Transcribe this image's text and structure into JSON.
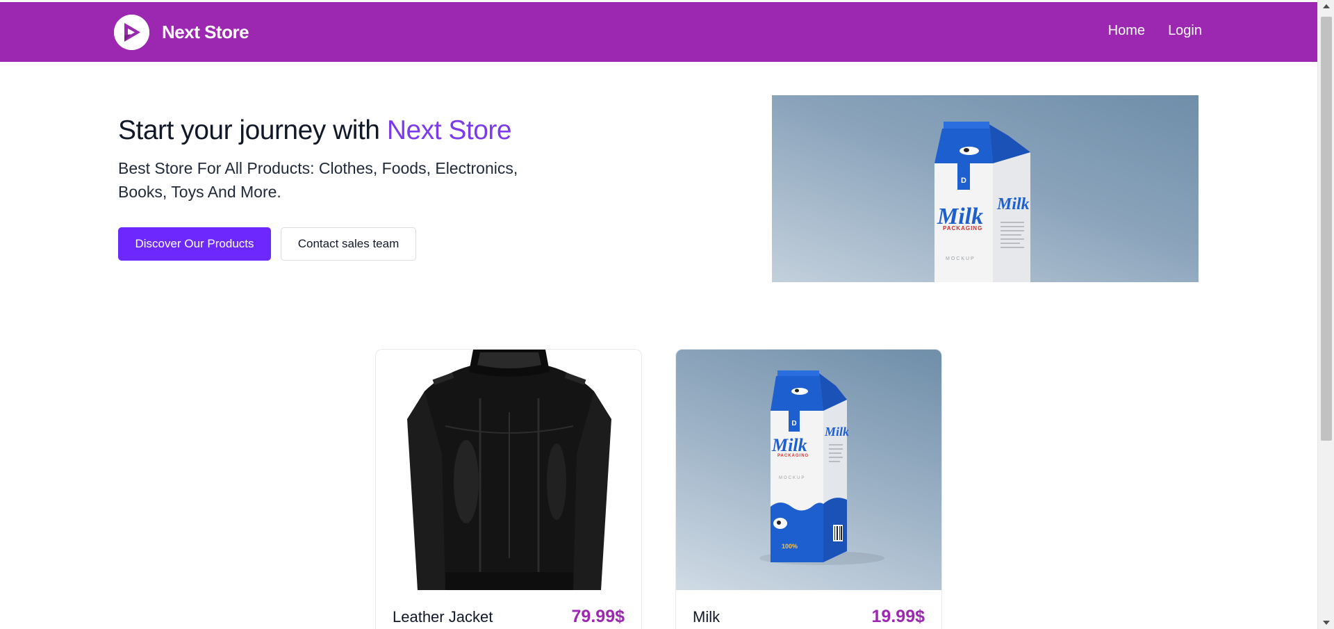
{
  "navbar": {
    "brand_name": "Next Store",
    "links": [
      {
        "label": "Home"
      },
      {
        "label": "Login"
      }
    ],
    "background_color": "#9c27b0"
  },
  "hero": {
    "title_prefix": "Start your journey with ",
    "title_accent": "Next Store",
    "description": "Best Store For All Products: Clothes, Foods, Electronics, Books, Toys And More.",
    "primary_button": "Discover Our Products",
    "secondary_button": "Contact sales team",
    "accent_color": "#7c3aed",
    "primary_color": "#6d28fe",
    "image": {
      "product_label": "Milk",
      "product_sublabel": "PACKAGING",
      "product_caption": "MOCKUP"
    }
  },
  "products": [
    {
      "name": "Leather Jacket",
      "price": "79.99$",
      "image_icon": "leather-jacket-image"
    },
    {
      "name": "Milk",
      "price": "19.99$",
      "image_icon": "milk-carton-image",
      "label": "Milk",
      "sublabel": "PACKAGING",
      "caption": "MOCKUP",
      "badge": "100%"
    }
  ],
  "price_color": "#9c27b0"
}
